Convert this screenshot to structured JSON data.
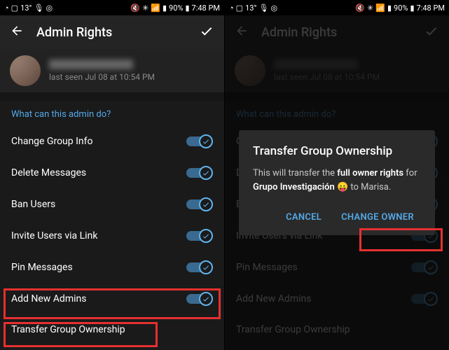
{
  "statusbar": {
    "temp": "13°",
    "battery": "90%",
    "time": "7:48 PM"
  },
  "header": {
    "title": "Admin Rights"
  },
  "profile": {
    "status": "last seen Jul 08 at 10:54 PM"
  },
  "section_title": "What can this admin do?",
  "permissions": [
    {
      "label": "Change Group Info"
    },
    {
      "label": "Delete Messages"
    },
    {
      "label": "Ban Users"
    },
    {
      "label": "Invite Users via Link"
    },
    {
      "label": "Pin Messages"
    },
    {
      "label": "Add New Admins"
    }
  ],
  "transfer_label": "Transfer Group Ownership",
  "dialog": {
    "title": "Transfer Group Ownership",
    "body_pre": "This will transfer the ",
    "body_strong": "full owner rights",
    "body_mid": " for ",
    "group": "Grupo Investigación",
    "emoji": "😛",
    "body_post": " to Marisa.",
    "cancel": "CANCEL",
    "confirm": "CHANGE OWNER"
  }
}
